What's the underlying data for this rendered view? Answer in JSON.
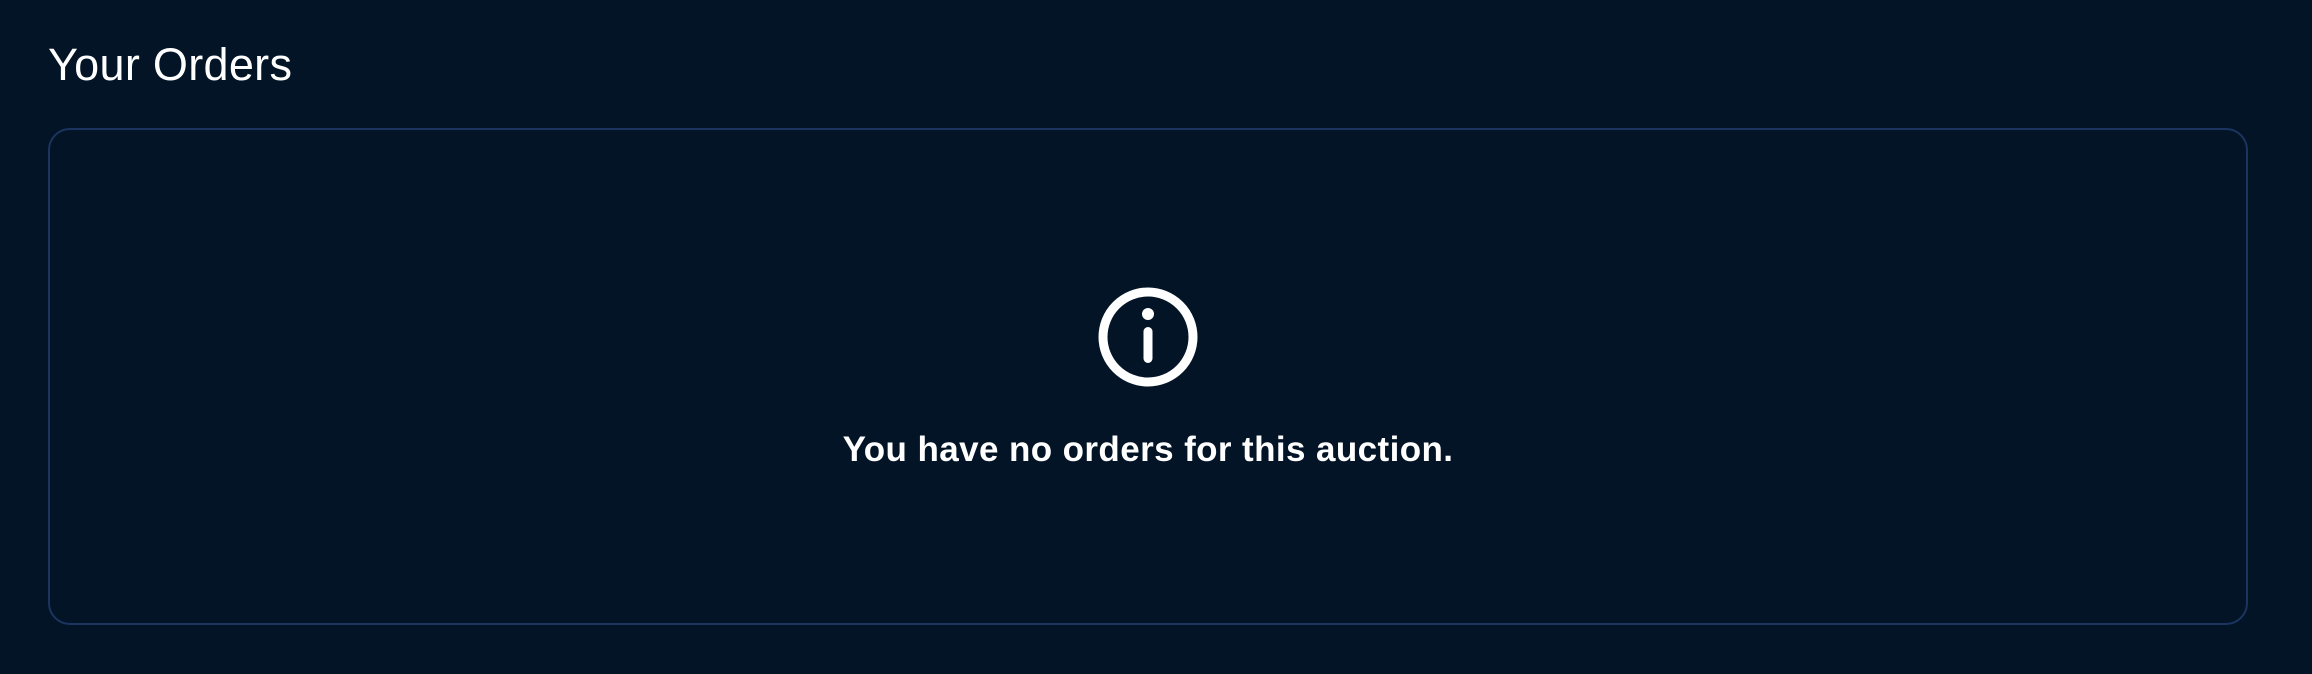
{
  "header": {
    "title": "Your Orders"
  },
  "orders_panel": {
    "empty_state": {
      "icon": "info-icon",
      "message": "You have no orders for this auction."
    }
  },
  "colors": {
    "background": "#021426",
    "panel_border": "#1b3460",
    "text": "#ffffff"
  }
}
